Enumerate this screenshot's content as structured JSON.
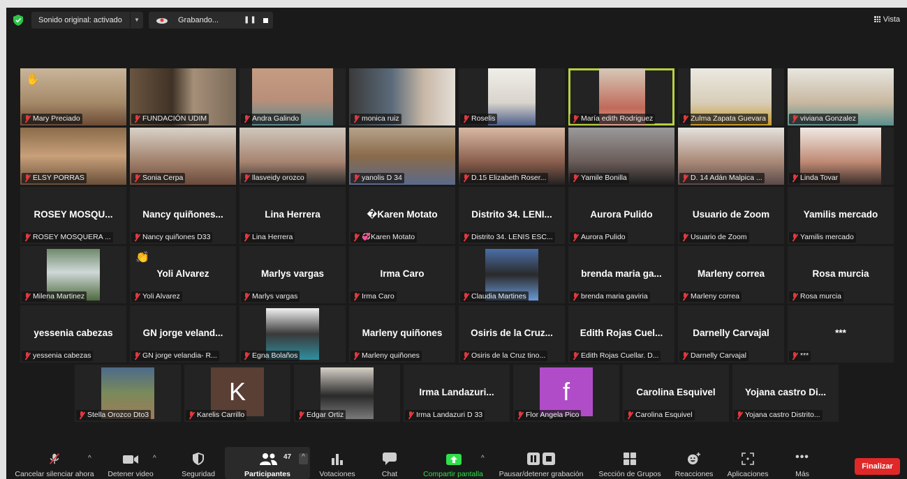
{
  "topbar": {
    "audio_label": "Sonido original: activado",
    "recording_label": "Grabando...",
    "view_label": "Vista"
  },
  "tiles": [
    {
      "name": "Mary Preciado",
      "big": "",
      "hand": true
    },
    {
      "name": "FUNDACIÓN UDIM",
      "big": ""
    },
    {
      "name": "Andra Galindo",
      "big": ""
    },
    {
      "name": "monica ruiz",
      "big": ""
    },
    {
      "name": "Roselis",
      "big": ""
    },
    {
      "name": "María edith Rodriguez",
      "big": "",
      "active": true
    },
    {
      "name": "Zulma Zapata Guevara",
      "big": ""
    },
    {
      "name": "viviana Gonzalez",
      "big": ""
    },
    {
      "name": "ELSY PORRAS",
      "big": ""
    },
    {
      "name": "Sonia Cerpa",
      "big": ""
    },
    {
      "name": "llasveidy orozco",
      "big": ""
    },
    {
      "name": "yanolis D 34",
      "big": ""
    },
    {
      "name": "D.15 Elizabeth Roser...",
      "big": ""
    },
    {
      "name": "Yamile Bonilla",
      "big": ""
    },
    {
      "name": "D. 14 Adán Malpica ...",
      "big": ""
    },
    {
      "name": "Linda Tovar",
      "big": ""
    },
    {
      "name": "ROSEY  MOSQUERA ...",
      "big": "ROSEY   MOSQU..."
    },
    {
      "name": "Nancy quiñones D33",
      "big": "Nancy  quiñones..."
    },
    {
      "name": "Lina Herrera",
      "big": "Lina Herrera"
    },
    {
      "name": "💞Karen Motato",
      "big": "�Karen  Motato"
    },
    {
      "name": "Distrito 34. LENIS ESC...",
      "big": "Distrito  34.  LENI..."
    },
    {
      "name": "Aurora Pulido",
      "big": "Aurora Pulido"
    },
    {
      "name": "Usuario de Zoom",
      "big": "Usuario de Zoom"
    },
    {
      "name": "Yamilis mercado",
      "big": "Yamilis mercado"
    },
    {
      "name": "Milena Martinez",
      "big": ""
    },
    {
      "name": "Yoli Alvarez",
      "big": "Yoli Alvarez",
      "clap": true
    },
    {
      "name": "Marlys vargas",
      "big": "Marlys vargas"
    },
    {
      "name": "Irma Caro",
      "big": "Irma Caro"
    },
    {
      "name": "Claudia Martines",
      "big": ""
    },
    {
      "name": "brenda maria gaviria",
      "big": "brenda  maria  ga..."
    },
    {
      "name": "Marleny correa",
      "big": "Marleny correa"
    },
    {
      "name": "Rosa murcia",
      "big": "Rosa murcia"
    },
    {
      "name": "yessenia cabezas",
      "big": "yessenia cabezas"
    },
    {
      "name": "GN jorge velandia- R...",
      "big": "GN  jorge  veland..."
    },
    {
      "name": "Egna Bolaños",
      "big": ""
    },
    {
      "name": "Marleny quiñones",
      "big": "Marleny quiñones"
    },
    {
      "name": "Osiris de la Cruz tino...",
      "big": "Osiris  de  la  Cruz..."
    },
    {
      "name": "Edith Rojas Cuellar. D...",
      "big": "Edith  Rojas  Cuel..."
    },
    {
      "name": "Darnelly Carvajal",
      "big": "Darnelly Carvajal"
    },
    {
      "name": "***",
      "big": "***"
    },
    {
      "name": "Stella Orozco Dto3",
      "big": ""
    },
    {
      "name": "Karelis Carrillo",
      "big": "",
      "initial": "K"
    },
    {
      "name": "Edgar Ortiz",
      "big": ""
    },
    {
      "name": "Irma Landazuri D 33",
      "big": "Irma  Landazuri..."
    },
    {
      "name": "Flor Angela Pico",
      "big": "",
      "initial": "f"
    },
    {
      "name": "Carolina Esquivel",
      "big": "Carolina Esquivel"
    },
    {
      "name": "Yojana castro Distrito...",
      "big": "Yojana  castro  Di..."
    }
  ],
  "toolbar": {
    "unmute": "Cancelar silenciar ahora",
    "video": "Detener video",
    "security": "Seguridad",
    "participants": "Participantes",
    "participants_count": "47",
    "polls": "Votaciones",
    "chat": "Chat",
    "share": "Compartir pantalla",
    "record": "Pausar/detener grabación",
    "breakout": "Sección de Grupos",
    "reactions": "Reacciones",
    "apps": "Aplicaciones",
    "more": "Más",
    "end": "Finalizar"
  },
  "colors": {
    "background": "#1a1a1a",
    "active_speaker": "#b8d13f",
    "share_green": "#2ee04a",
    "end_red": "#e02828",
    "muted_red": "#e0393e"
  }
}
